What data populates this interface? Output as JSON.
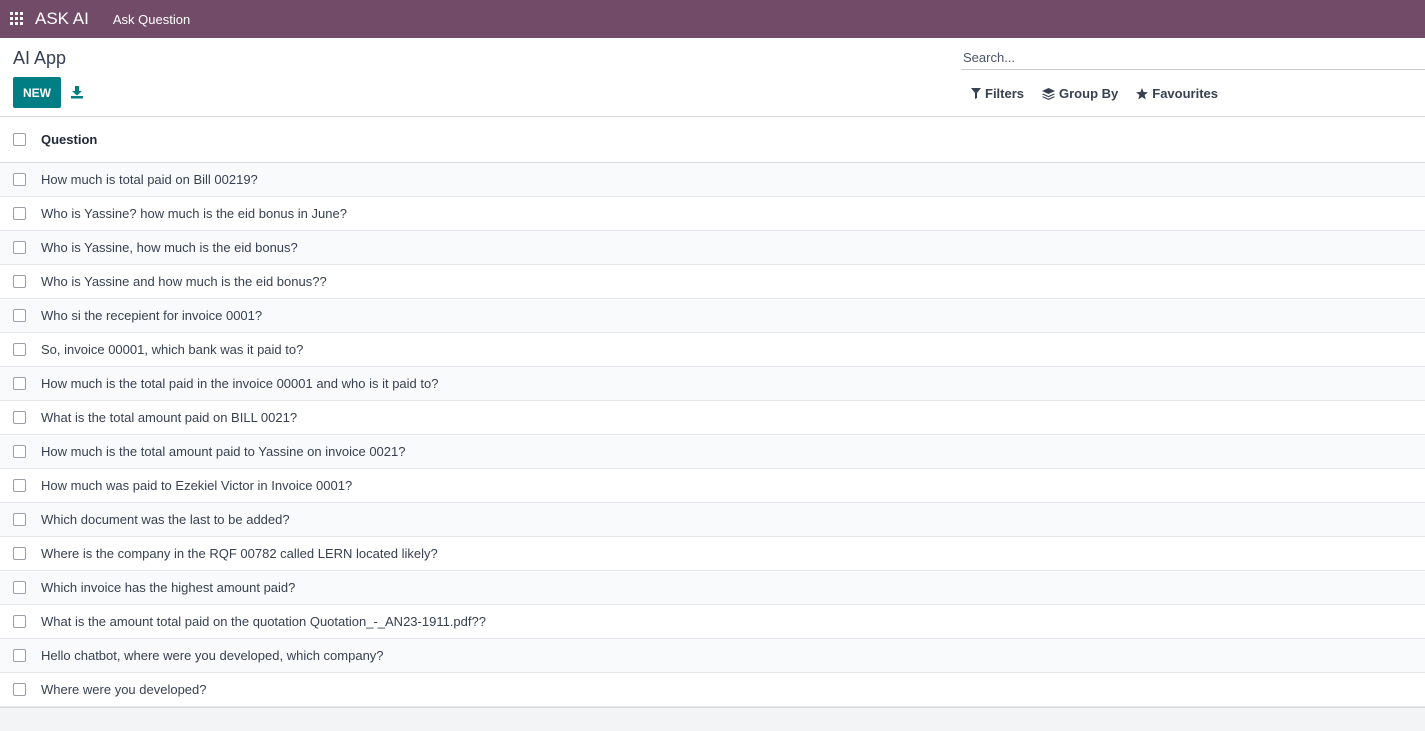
{
  "navbar": {
    "brand": "ASK AI",
    "menu_item": "Ask Question",
    "background": "#714b67"
  },
  "control_panel": {
    "breadcrumb": "AI App",
    "new_label": "NEW",
    "download_icon": "download-icon",
    "search_placeholder": "Search...",
    "filters_label": "Filters",
    "group_by_label": "Group By",
    "favourites_label": "Favourites",
    "accent": "#017e84"
  },
  "list": {
    "column_header": "Question",
    "rows": [
      "How much is total paid on Bill 00219?",
      "Who is Yassine? how much is the eid bonus in June?",
      "Who is Yassine, how much is the eid bonus?",
      "Who is Yassine and how much is the eid bonus??",
      "Who si the recepient for invoice 0001?",
      "So, invoice 00001, which bank was it paid to?",
      "How much is the total paid in the invoice 00001 and who is it paid to?",
      "What is the total amount paid on BILL 0021?",
      "How much is the total amount paid to Yassine on invoice 0021?",
      "How much was paid to Ezekiel Victor in Invoice 0001?",
      "Which document was the last to be added?",
      "Where is the company in the RQF 00782 called LERN located likely?",
      "Which invoice has the highest amount paid?",
      "What is the amount total paid on the quotation Quotation_-_AN23-1911.pdf??",
      "Hello chatbot, where were you developed, which company?",
      "Where were you developed?"
    ]
  }
}
